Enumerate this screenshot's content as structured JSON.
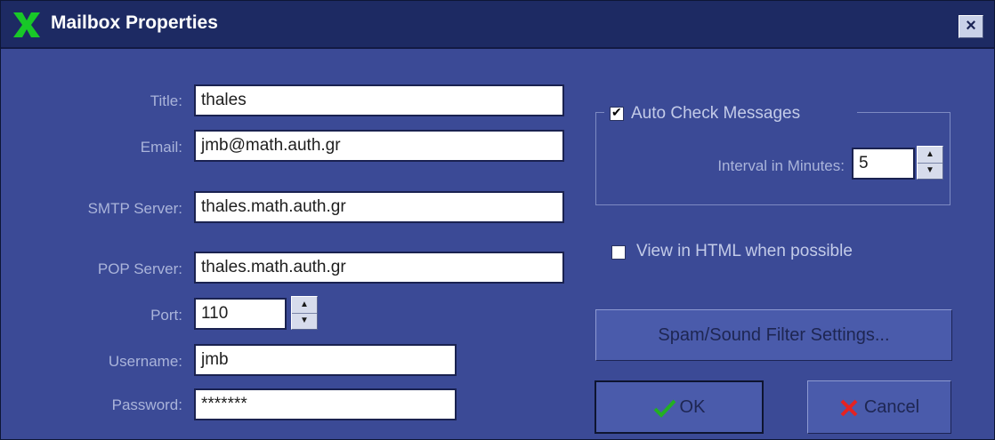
{
  "window": {
    "title": "Mailbox Properties",
    "close_glyph": "×"
  },
  "icons": {
    "logo": "x-app-logo-icon",
    "ok": "checkmark-icon",
    "cancel": "x-cancel-icon",
    "close": "close-icon"
  },
  "colors": {
    "window_bg": "#3b4a96",
    "titlebar_bg": "#1d2a63",
    "ok_icon": "#22b022",
    "cancel_icon": "#e52222",
    "logo": "#18c828"
  },
  "form": {
    "title_label": "Title:",
    "title_value": "thales",
    "email_label": "Email:",
    "email_value": "jmb@math.auth.gr",
    "smtp_label": "SMTP Server:",
    "smtp_value": "thales.math.auth.gr",
    "pop_label": "POP Server:",
    "pop_value": "thales.math.auth.gr",
    "port_label": "Port:",
    "port_value": "110",
    "username_label": "Username:",
    "username_value": "jmb",
    "password_label": "Password:",
    "password_value": "*******"
  },
  "auto_check": {
    "label": "Auto Check Messages",
    "checked": true,
    "interval_label": "Interval in Minutes:",
    "interval_value": "5"
  },
  "view_html": {
    "label": "View in HTML when possible",
    "checked": false
  },
  "buttons": {
    "spam_filter": "Spam/Sound Filter Settings...",
    "ok": "OK",
    "cancel": "Cancel"
  }
}
